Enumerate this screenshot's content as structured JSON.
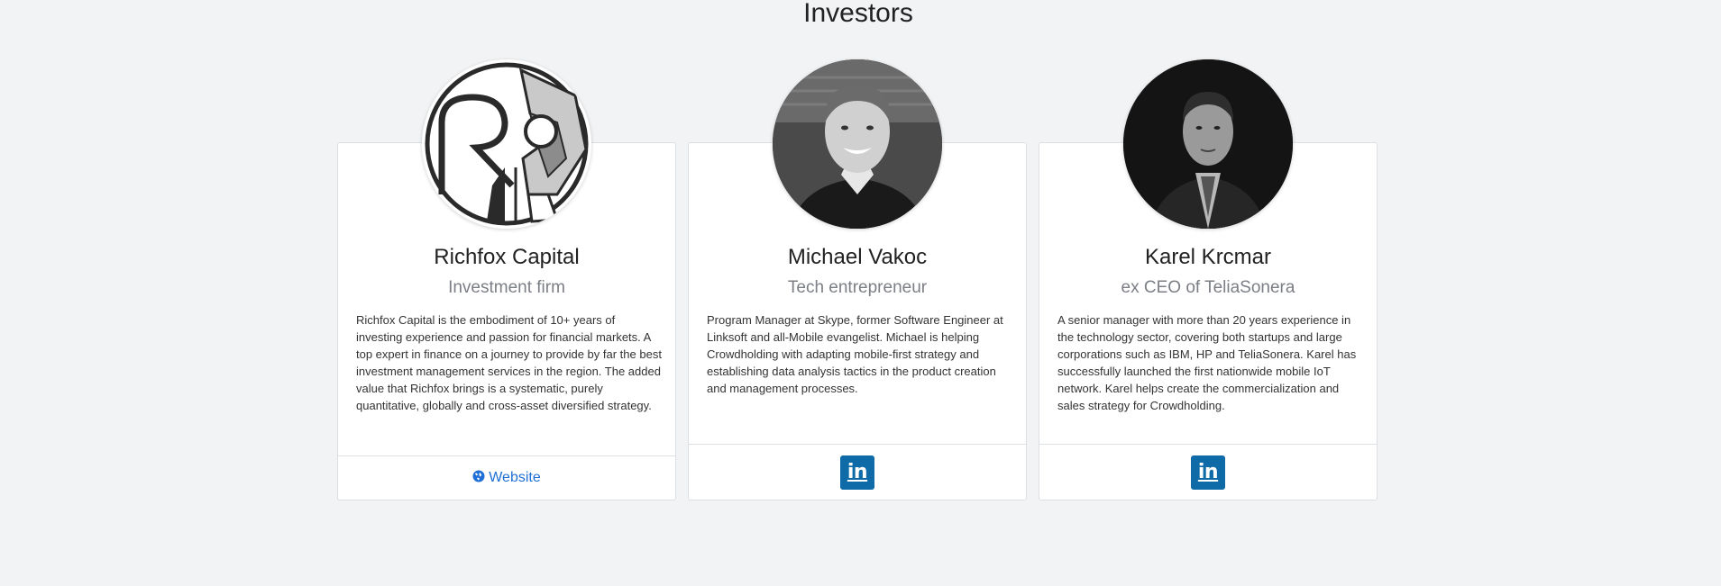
{
  "section": {
    "title": "Investors"
  },
  "investors": [
    {
      "name": "Richfox Capital",
      "role": "Investment firm",
      "description": "Richfox Capital is the embodiment of 10+ years of investing experience and passion for financial markets. A top expert in finance on a journey to provide by far the best investment management services in the region. The added value that Richfox brings is a systematic, purely quantitative, globally and cross-asset diversified strategy.",
      "link_label": "Website",
      "link_icon": "globe-icon"
    },
    {
      "name": "Michael Vakoc",
      "role": "Tech entrepreneur",
      "description": "Program Manager at Skype, former Software Engineer at Linksoft and all-Mobile evangelist. Michael is helping Crowdholding with adapting mobile-first strategy and establishing data analysis tactics in the product creation and management processes.",
      "link_label": "in",
      "link_icon": "linkedin-icon"
    },
    {
      "name": "Karel Krcmar",
      "role": "ex CEO of TeliaSonera",
      "description": "A senior manager with more than 20 years experience in the technology sector, covering both startups and large corporations such as IBM, HP and TeliaSonera. Karel has successfully launched the first nationwide mobile IoT network. Karel helps create the commercialization and sales strategy for Crowdholding.",
      "link_label": "in",
      "link_icon": "linkedin-icon"
    }
  ],
  "colors": {
    "page_background": "#f1f3f5",
    "link_blue": "#1f6fd6",
    "linkedin_blue": "#0e6ba8",
    "role_gray": "#7b7f85"
  }
}
